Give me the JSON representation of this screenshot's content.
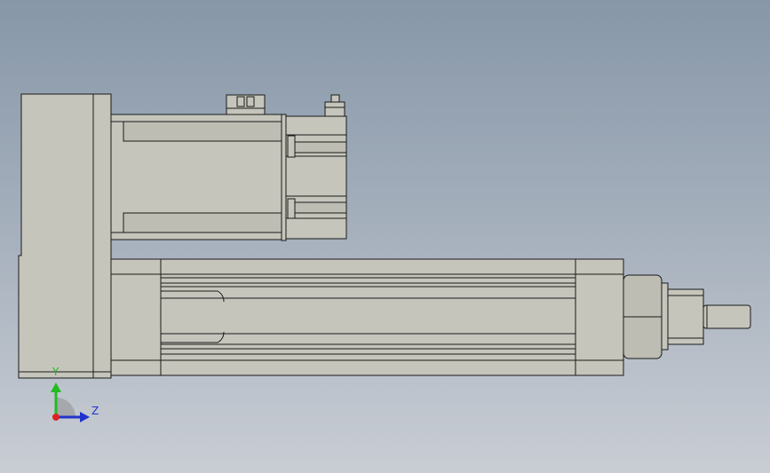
{
  "view": {
    "background_top": "#8797a8",
    "background_bottom": "#c9cdd4",
    "part_fill": "#c5c5bc",
    "part_fill_dark": "#aeaea6",
    "edge_color": "#1a1a1a"
  },
  "triad": {
    "y_label": "Y",
    "z_label": "Z",
    "y_color": "#22bb22",
    "z_color": "#2233cc",
    "origin_color": "#dd2222",
    "fan_color": "#a6a8ad"
  }
}
